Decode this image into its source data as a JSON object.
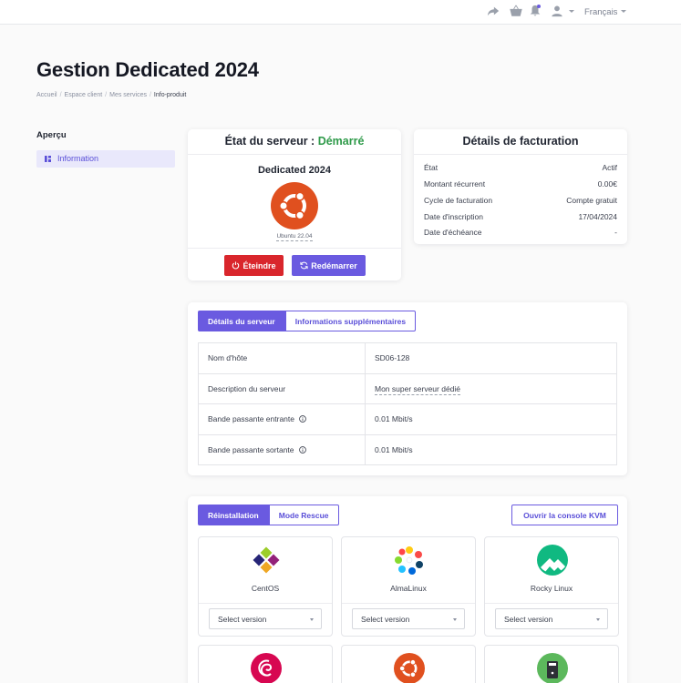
{
  "topbar": {
    "icons": [
      "share-icon",
      "basket-icon",
      "bell-icon",
      "user-icon"
    ],
    "language": "Français"
  },
  "page": {
    "title": "Gestion Dedicated 2024",
    "breadcrumb": [
      "Accueil",
      "Espace client",
      "Mes services",
      "Info-produit"
    ]
  },
  "sidebar": {
    "title": "Aperçu",
    "items": [
      {
        "label": "Information",
        "icon": "info-grid-icon"
      }
    ]
  },
  "server": {
    "status_label": "État du serveur :",
    "status_value": "Démarré",
    "product_name": "Dedicated 2024",
    "os": "Ubuntu 22.04",
    "stop_label": "Éteindre",
    "restart_label": "Redémarrer"
  },
  "billing": {
    "title": "Détails de facturation",
    "rows": [
      {
        "label": "État",
        "value": "Actif"
      },
      {
        "label": "Montant récurrent",
        "value": "0.00€"
      },
      {
        "label": "Cycle de facturation",
        "value": "Compte gratuit"
      },
      {
        "label": "Date d'inscription",
        "value": "17/04/2024"
      },
      {
        "label": "Date d'échéance",
        "value": "-"
      }
    ]
  },
  "details": {
    "tabs": [
      "Détails du serveur",
      "Informations supplémentaires"
    ],
    "rows": [
      {
        "label": "Nom d'hôte",
        "value": "SD06-128"
      },
      {
        "label": "Description du serveur",
        "value": "Mon super serveur dédié"
      },
      {
        "label": "Bande passante entrante",
        "value": "0.01 Mbit/s"
      },
      {
        "label": "Bande passante sortante",
        "value": "0.01 Mbit/s"
      }
    ]
  },
  "install": {
    "tabs": [
      "Réinstallation",
      "Mode Rescue"
    ],
    "kvm_label": "Ouvrir la console KVM",
    "os_list": [
      {
        "name": "CentOS",
        "select_placeholder": "Select version"
      },
      {
        "name": "AlmaLinux",
        "select_placeholder": "Select version"
      },
      {
        "name": "Rocky Linux",
        "select_placeholder": "Select version"
      }
    ]
  },
  "colors": {
    "accent": "#6a5ae0",
    "status_green": "#2e9a49",
    "danger": "#d9262c",
    "ubuntu": "#e0501f"
  }
}
